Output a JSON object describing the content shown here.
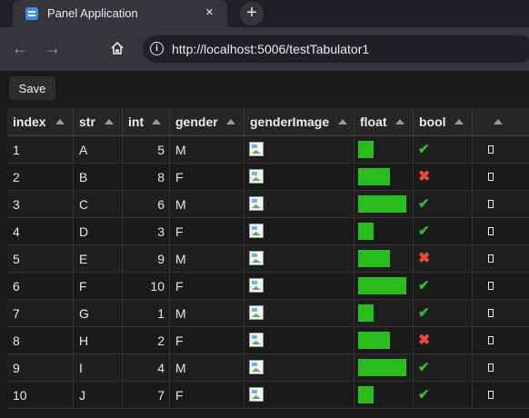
{
  "browser": {
    "tab_title": "Panel Application",
    "tab_close": "×",
    "new_tab": "+",
    "url": "http://localhost:5006/testTabulator1",
    "icons": [
      "back-arrow-icon",
      "forward-arrow-icon",
      "home-icon",
      "info-icon"
    ]
  },
  "toolbar": {
    "save_label": "Save"
  },
  "table": {
    "columns": [
      "index",
      "str",
      "int",
      "gender",
      "genderImage",
      "float",
      "bool",
      ""
    ],
    "float_range": [
      0,
      1
    ],
    "bar_color": "#2bbd1d",
    "check_color": "#31b835",
    "cross_color": "#e5493a",
    "rows": [
      {
        "index": "1",
        "str": "A",
        "int": "5",
        "gender": "M",
        "float": 0.33,
        "bool": true
      },
      {
        "index": "2",
        "str": "B",
        "int": "8",
        "gender": "F",
        "float": 0.66,
        "bool": false
      },
      {
        "index": "3",
        "str": "C",
        "int": "6",
        "gender": "M",
        "float": 1.0,
        "bool": true
      },
      {
        "index": "4",
        "str": "D",
        "int": "3",
        "gender": "F",
        "float": 0.33,
        "bool": true
      },
      {
        "index": "5",
        "str": "E",
        "int": "9",
        "gender": "M",
        "float": 0.66,
        "bool": false
      },
      {
        "index": "6",
        "str": "F",
        "int": "10",
        "gender": "F",
        "float": 1.0,
        "bool": true
      },
      {
        "index": "7",
        "str": "G",
        "int": "1",
        "gender": "M",
        "float": 0.33,
        "bool": true
      },
      {
        "index": "8",
        "str": "H",
        "int": "2",
        "gender": "F",
        "float": 0.66,
        "bool": false
      },
      {
        "index": "9",
        "str": "I",
        "int": "4",
        "gender": "M",
        "float": 1.0,
        "bool": true
      },
      {
        "index": "10",
        "str": "J",
        "int": "7",
        "gender": "F",
        "float": 0.33,
        "bool": true
      }
    ]
  }
}
